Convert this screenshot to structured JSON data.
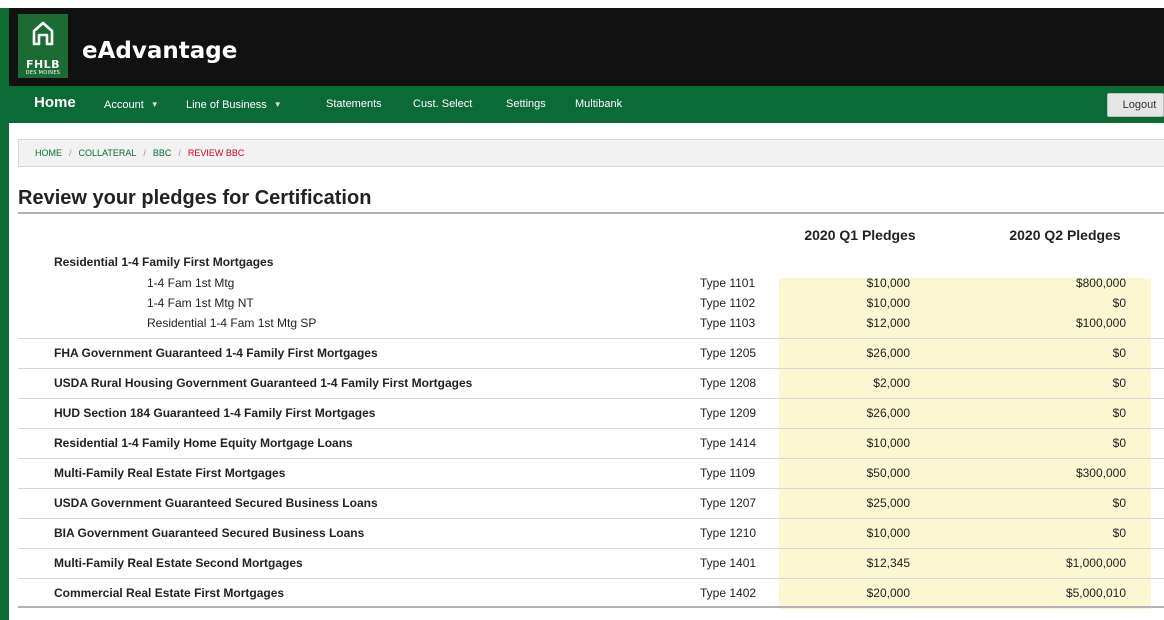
{
  "header": {
    "logo_text": "FHLB",
    "logo_subtext": "DES MOINES",
    "app_title": "eAdvantage"
  },
  "nav": {
    "home": "Home",
    "account": "Account",
    "line_of_business": "Line of Business",
    "statements": "Statements",
    "cust_select": "Cust. Select",
    "settings": "Settings",
    "multibank": "Multibank",
    "logout": "Logout"
  },
  "breadcrumb": [
    "HOME",
    "COLLATERAL",
    "BBC",
    "REVIEW BBC"
  ],
  "page_title": "Review your pledges for Certification",
  "table": {
    "col_q1": "2020 Q1 Pledges",
    "col_q2": "2020 Q2 Pledges",
    "group": {
      "label": "Residential 1-4 Family First Mortgages",
      "items": [
        {
          "label": "1-4 Fam 1st Mtg",
          "type": "Type 1101",
          "q1": "$10,000",
          "q2": "$800,000"
        },
        {
          "label": "1-4 Fam 1st Mtg NT",
          "type": "Type 1102",
          "q1": "$10,000",
          "q2": "$0"
        },
        {
          "label": "Residential 1-4 Fam 1st Mtg SP",
          "type": "Type 1103",
          "q1": "$12,000",
          "q2": "$100,000"
        }
      ]
    },
    "rows": [
      {
        "label": "FHA Government Guaranteed 1-4 Family First Mortgages",
        "type": "Type 1205",
        "q1": "$26,000",
        "q2": "$0"
      },
      {
        "label": "USDA Rural Housing Government Guaranteed 1-4 Family First Mortgages",
        "type": "Type 1208",
        "q1": "$2,000",
        "q2": "$0"
      },
      {
        "label": "HUD Section 184 Guaranteed 1-4 Family First Mortgages",
        "type": "Type 1209",
        "q1": "$26,000",
        "q2": "$0"
      },
      {
        "label": "Residential 1-4 Family Home Equity Mortgage Loans",
        "type": "Type 1414",
        "q1": "$10,000",
        "q2": "$0"
      },
      {
        "label": "Multi-Family Real Estate First Mortgages",
        "type": "Type 1109",
        "q1": "$50,000",
        "q2": "$300,000"
      },
      {
        "label": "USDA Government Guaranteed Secured Business Loans",
        "type": "Type 1207",
        "q1": "$25,000",
        "q2": "$0"
      },
      {
        "label": "BIA Government Guaranteed Secured Business Loans",
        "type": "Type 1210",
        "q1": "$10,000",
        "q2": "$0"
      },
      {
        "label": "Multi-Family Real Estate Second Mortgages",
        "type": "Type 1401",
        "q1": "$12,345",
        "q2": "$1,000,000"
      },
      {
        "label": "Commercial Real Estate First Mortgages",
        "type": "Type 1402",
        "q1": "$20,000",
        "q2": "$5,000,010"
      }
    ]
  }
}
